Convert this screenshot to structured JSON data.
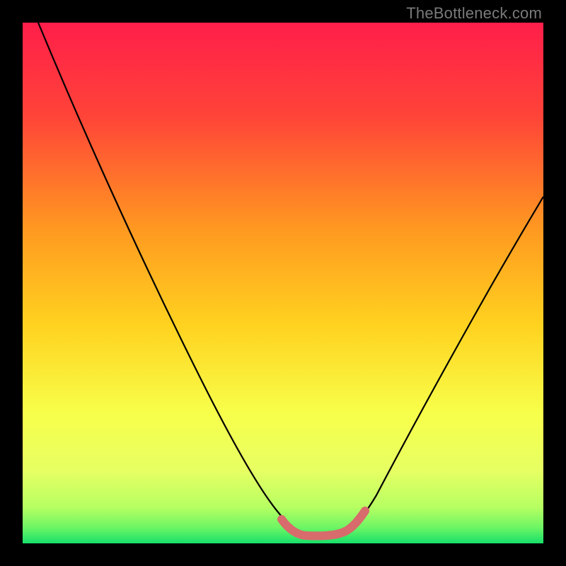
{
  "watermark": "TheBottleneck.com",
  "colors": {
    "gradient_top": "#ff1e4a",
    "gradient_mid1": "#ff7a2a",
    "gradient_mid2": "#ffd21f",
    "gradient_mid3": "#f7ff4a",
    "gradient_bottom": "#16e06a",
    "curve": "#000000",
    "highlight": "#d86b6b",
    "frame": "#000000"
  },
  "chart_data": {
    "type": "line",
    "title": "",
    "xlabel": "",
    "ylabel": "",
    "xlim": [
      0,
      100
    ],
    "ylim": [
      0,
      100
    ],
    "x": [
      3,
      6,
      10,
      15,
      20,
      25,
      30,
      35,
      40,
      45,
      48,
      50,
      52,
      54,
      56,
      58,
      60,
      62,
      65,
      70,
      75,
      80,
      85,
      90,
      95,
      100
    ],
    "values": [
      100,
      93,
      85,
      76,
      68,
      59,
      50,
      41,
      32,
      22,
      14,
      8,
      4,
      2,
      1.5,
      1.5,
      2,
      4,
      8,
      16,
      24,
      32,
      40,
      48,
      55,
      62
    ],
    "highlight_range_x": [
      50,
      62
    ],
    "annotations": [
      "TheBottleneck.com"
    ]
  }
}
